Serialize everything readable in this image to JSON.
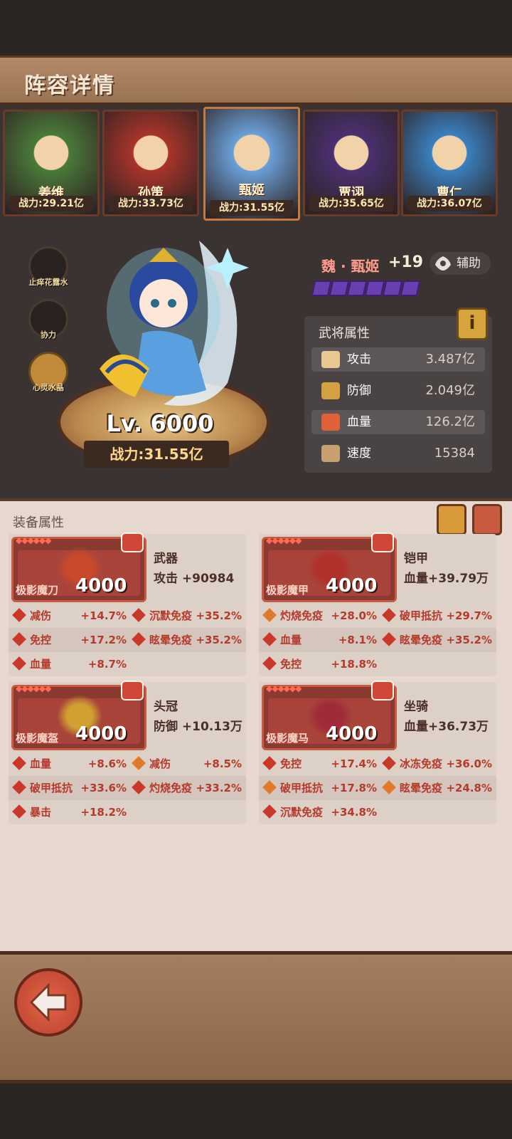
{
  "header": {
    "title": "阵容详情"
  },
  "lineup": [
    {
      "name": "姜维",
      "power": "战力:29.21亿",
      "color": "#4a7a3a"
    },
    {
      "name": "孙策",
      "power": "战力:33.73亿",
      "color": "#a8342a"
    },
    {
      "name": "甄姬",
      "power": "战力:31.55亿",
      "color": "#6aa0d8",
      "selected": true
    },
    {
      "name": "贾诩",
      "power": "战力:35.65亿",
      "color": "#4a3070"
    },
    {
      "name": "曹仁",
      "power": "战力:36.07亿",
      "color": "#3a80c0"
    }
  ],
  "hero": {
    "name": "魏 · 甄姬",
    "plus": "+19",
    "role": "辅助",
    "stars": 6,
    "level": "Lv. 6000",
    "power": "战力:31.55亿",
    "side_items": [
      "止痒花露水",
      "协力",
      "心灵水晶"
    ]
  },
  "attributes": {
    "title": "武将属性",
    "info_label": "i",
    "rows": [
      {
        "key": "攻击",
        "value": "3.487亿",
        "icon": "sword-icon"
      },
      {
        "key": "防御",
        "value": "2.049亿",
        "icon": "shield-icon"
      },
      {
        "key": "血量",
        "value": "126.2亿",
        "icon": "blood-icon"
      },
      {
        "key": "速度",
        "value": "15384",
        "icon": "boot-icon"
      }
    ]
  },
  "equipment": {
    "title": "装备属性",
    "items": [
      {
        "set_name": "极影魔刀",
        "level": "4000",
        "slot": "武器",
        "main_stat": "攻击 +90984",
        "subs": [
          [
            "减伤",
            "+14.7%",
            "red"
          ],
          [
            "沉默免疫",
            "+35.2%",
            "red"
          ],
          [
            "免控",
            "+17.2%",
            "red"
          ],
          [
            "眩晕免疫",
            "+35.2%",
            "red"
          ],
          [
            "血量",
            "+8.7%",
            "red"
          ]
        ]
      },
      {
        "set_name": "极影魔甲",
        "level": "4000",
        "slot": "铠甲",
        "main_stat": "血量+39.79万",
        "subs": [
          [
            "灼烧免疫",
            "+28.0%",
            "orange"
          ],
          [
            "破甲抵抗",
            "+29.7%",
            "red"
          ],
          [
            "血量",
            "+8.1%",
            "red"
          ],
          [
            "眩晕免疫",
            "+35.2%",
            "red"
          ],
          [
            "免控",
            "+18.8%",
            "red"
          ]
        ]
      },
      {
        "set_name": "极影魔盔",
        "level": "4000",
        "slot": "头冠",
        "main_stat": "防御 +10.13万",
        "subs": [
          [
            "血量",
            "+8.6%",
            "red"
          ],
          [
            "减伤",
            "+8.5%",
            "orange"
          ],
          [
            "破甲抵抗",
            "+33.6%",
            "red"
          ],
          [
            "灼烧免疫",
            "+33.2%",
            "red"
          ],
          [
            "暴击",
            "+18.2%",
            "red"
          ]
        ]
      },
      {
        "set_name": "极影魔马",
        "level": "4000",
        "slot": "坐骑",
        "main_stat": "血量+36.73万",
        "subs": [
          [
            "免控",
            "+17.4%",
            "red"
          ],
          [
            "冰冻免疫",
            "+36.0%",
            "red"
          ],
          [
            "破甲抵抗",
            "+17.8%",
            "orange"
          ],
          [
            "眩晕免疫",
            "+24.8%",
            "orange"
          ],
          [
            "沉默免疫",
            "+34.8%",
            "red"
          ]
        ]
      }
    ]
  },
  "colors": {
    "red": "#c9382a",
    "orange": "#e07a28"
  }
}
